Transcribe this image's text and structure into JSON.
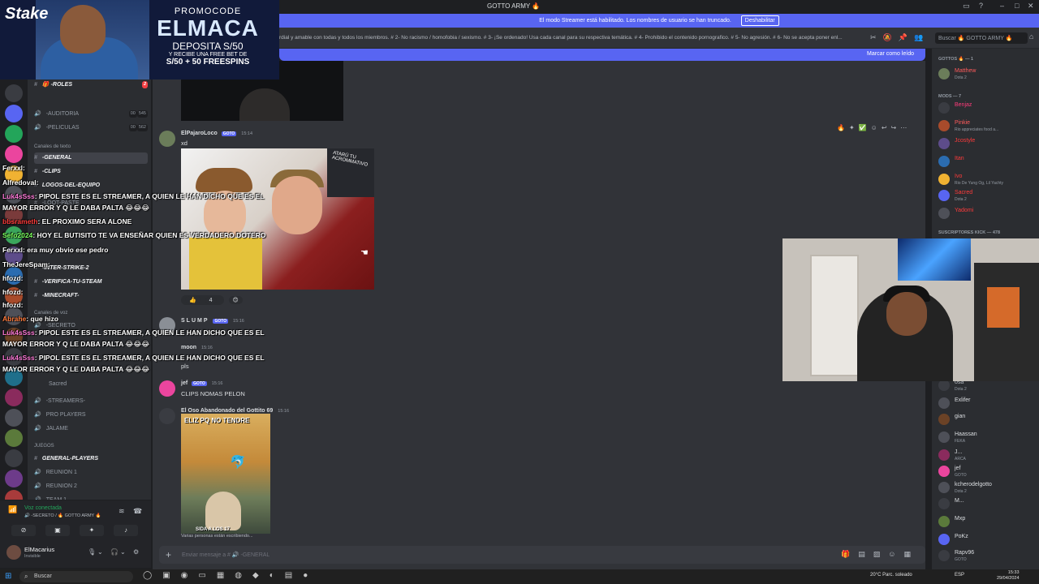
{
  "window": {
    "title": "GOTTO ARMY 🔥"
  },
  "promo": {
    "brand": "Stake",
    "label": "PROMOCODE",
    "code": "ELMACA",
    "deposit": "DEPOSITA S/50",
    "bonus_line": "Y RECIBE UNA FREE BET DE",
    "spins": "S/50 + 50 FREESPINS"
  },
  "streamer_banner": {
    "text": "El modo Streamer está habilitado. Los nombres de usuario se han truncado.",
    "button": "Deshabilitar"
  },
  "topic": {
    "text": "rdial y amable con todas y todos los miembros. # 2- No racismo / homofobia / sexismo. # 3- ¡Se ordenado! Usa cada canal para su respectiva temática. # 4- Prohibido el contenido pornografico. # 5- No agresión. # 6- No se acepta poner enl...",
    "search_placeholder": "Buscar 🔥 GOTTO ARMY 🔥"
  },
  "unread_bar": {
    "label": "Marcar como leído"
  },
  "sidebar": {
    "items": [
      {
        "icon": "#",
        "label": "🎁 -ROLES",
        "bold": true,
        "badge": "2"
      },
      {
        "icon": "🔊",
        "label": "-AUDITORIA",
        "count_a": "00",
        "count_b": "545"
      },
      {
        "icon": "🔊",
        "label": "-PELICULAS",
        "count_a": "00",
        "count_b": "562"
      },
      {
        "category": "Canales de texto"
      },
      {
        "icon": "#",
        "label": "-GENERAL",
        "bold": true,
        "active": true
      },
      {
        "icon": "#",
        "label": "-CLIPS",
        "bold": true
      },
      {
        "icon": "#",
        "label": "LOGOS-DEL-EQUIPO",
        "bold": true
      },
      {
        "icon": "#",
        "label": "-LOOT-PASTE"
      },
      {
        "icon": "#",
        "label": "-INTER-STRIKE-2",
        "bold": true
      },
      {
        "icon": "#",
        "label": "-VERIFICA-TU-STEAM",
        "bold": true
      },
      {
        "icon": "#",
        "label": "-MINECRAFT-",
        "bold": true
      },
      {
        "category": "Canales de voz"
      },
      {
        "icon": "🔊",
        "label": "-SECRETO"
      },
      {
        "icon": "🔊",
        "label": "-STREAMERS-"
      },
      {
        "icon": "🔊",
        "label": "PRO PLAYERS"
      },
      {
        "icon": "🔊",
        "label": "JALAME"
      },
      {
        "category": "JUEGOS"
      },
      {
        "icon": "#",
        "label": "GENERAL-PLAYERS",
        "bold": true
      },
      {
        "icon": "🔊",
        "label": "REUNION 1"
      },
      {
        "icon": "🔊",
        "label": "REUNION 2"
      },
      {
        "icon": "🔊",
        "label": "TEAM 1"
      }
    ],
    "voice_user": "Sacred"
  },
  "voice_panel": {
    "status": "Voz conectada",
    "channel": "🔊 -SECRETO / 🔥 GOTTO ARMY 🔥"
  },
  "user_panel": {
    "name": "ElMacarius",
    "status": "Invisible"
  },
  "chat_overlay": [
    {
      "user": "Ferxxl",
      "text": "",
      "color": "#ffffff"
    },
    {
      "user": "Alfredoval",
      "text": "",
      "color": "#ffffff"
    },
    {
      "user": "Luk4sSss",
      "text": "PIPOL ESTE ES EL STREAMER, A QUIEN LE HAN DICHO QUE ES EL",
      "color": "#ff7ad9"
    },
    {
      "user": "",
      "text": "MAYOR ERROR Y Q LE DABA PALTA 😂😂😂",
      "color": "#ffffff"
    },
    {
      "user": "bbsrameth",
      "text": "EL PROXIMO SERA ALONE",
      "color": "#ff3b3b"
    },
    {
      "user": "Sefo2024",
      "text": "HOY EL BUTISITO TE VA ENSEÑAR QUIEN ES VERDADERO DOTERO",
      "color": "#7cff5e"
    },
    {
      "user": "Ferxxl",
      "text": "era muy obvio ese pedro",
      "color": "#ffffff"
    },
    {
      "user": "TheJereSpam",
      "text": "",
      "color": "#ffffff"
    },
    {
      "user": "hfozd",
      "text": "",
      "color": "#ffffff"
    },
    {
      "user": "hfozd",
      "text": "",
      "color": "#ffffff"
    },
    {
      "user": "hfozd",
      "text": "",
      "color": "#ffffff"
    },
    {
      "user": "Abrahe",
      "text": "que hizo",
      "color": "#ff7a3b"
    },
    {
      "user": "Luk4sSss",
      "text": "PIPOL ESTE ES EL STREAMER, A QUIEN LE HAN DICHO QUE ES EL",
      "color": "#ff7ad9"
    },
    {
      "user": "",
      "text": "MAYOR ERROR Y Q LE DABA PALTA 😂😂😂",
      "color": "#ffffff"
    },
    {
      "user": "Luk4sSss",
      "text": "PIPOL ESTE ES EL STREAMER, A QUIEN LE HAN DICHO QUE ES EL",
      "color": "#ff7ad9"
    },
    {
      "user": "",
      "text": "MAYOR ERROR Y Q LE DABA PALTA 😂😂😂",
      "color": "#ffffff"
    }
  ],
  "messages": [
    {
      "author": "ElPajaroLoco",
      "tag": "GOTO",
      "time": "15:14",
      "text": "xd",
      "color": "#ff5b5b"
    },
    {
      "author": "SLUMP",
      "tag": "GOTO",
      "time": "15:16",
      "text": "",
      "color": "#b5bac1"
    },
    {
      "author": "moon",
      "tag": "",
      "time": "15:16",
      "text": "pls",
      "color": "#ff7a3b"
    },
    {
      "author": "jef",
      "tag": "GOTO",
      "time": "15:16",
      "text": "CLIPS NOMAS PELON",
      "color": "#f2f3f5"
    },
    {
      "author": "El Oso Abandonado del Gottito 69",
      "tag": "",
      "time": "15:16",
      "text": "",
      "color": "#c9a0ff"
    }
  ],
  "photo": {
    "sign_text": "ATARÚ TU ACROMMATIVO"
  },
  "meme": {
    "caption": "ELIZ PQ NO TENDRE",
    "bottom": "SIDA A LOS 17"
  },
  "reactions": [
    {
      "emoji": "👍",
      "count": "4"
    },
    {
      "emoji": "😊",
      "count": ""
    }
  ],
  "typing": "Varias personas están escribiendo...",
  "composer": {
    "placeholder": "Enviar mensaje a # 🔊 -GENERAL"
  },
  "members": {
    "groups": [
      {
        "label": "GOTTOS 🔥 — 1"
      },
      {
        "label": "MODS — 7"
      },
      {
        "label": "SUSCRIPTORES KICK — 478"
      }
    ],
    "list": [
      {
        "name": "Matthew",
        "sub": "Dota 2",
        "color": "#ff5b5b"
      },
      {
        "name": "Benjaz",
        "sub": "",
        "color": "#ff3b7a"
      },
      {
        "name": "Pinkie",
        "sub": "Rio appreciates food a...",
        "color": "#ff5b5b"
      },
      {
        "name": "Jcostyle",
        "sub": "",
        "color": "#ff3b3b"
      },
      {
        "name": "Itan",
        "sub": "",
        "color": "#ff3b3b"
      },
      {
        "name": "Ivo",
        "sub": "Rio De Yung Og, Lil Yachty",
        "color": "#ff3b3b"
      },
      {
        "name": "Sacred",
        "sub": "Dota 2",
        "color": "#ff3b3b"
      },
      {
        "name": "Yadomi",
        "sub": "",
        "color": "#ff3b3b"
      },
      {
        "name": "osa",
        "sub": "Dota 2",
        "color": "#b5bac1"
      },
      {
        "name": "Exlifer",
        "sub": "",
        "color": "#dbdee1"
      },
      {
        "name": "gian",
        "sub": "",
        "color": "#dbdee1"
      },
      {
        "name": "Haassan",
        "sub": "FEKA",
        "color": "#dbdee1"
      },
      {
        "name": "J...",
        "sub": "ARCA",
        "color": "#dbdee1"
      },
      {
        "name": "jef",
        "sub": "GOTO",
        "color": "#dbdee1"
      },
      {
        "name": "kcherodelgotto",
        "sub": "Dota 2",
        "color": "#dbdee1"
      },
      {
        "name": "M...",
        "sub": "",
        "color": "#dbdee1"
      },
      {
        "name": "Mxp",
        "sub": "",
        "color": "#dbdee1"
      },
      {
        "name": "PoKz",
        "sub": "",
        "color": "#dbdee1"
      },
      {
        "name": "Rapv96",
        "sub": "GOTO",
        "color": "#dbdee1"
      }
    ]
  },
  "taskbar": {
    "search": "Buscar",
    "weather": "20°C Parc. soleado",
    "lang": "ESP",
    "time": "15:33",
    "date": "29/04/2024"
  }
}
